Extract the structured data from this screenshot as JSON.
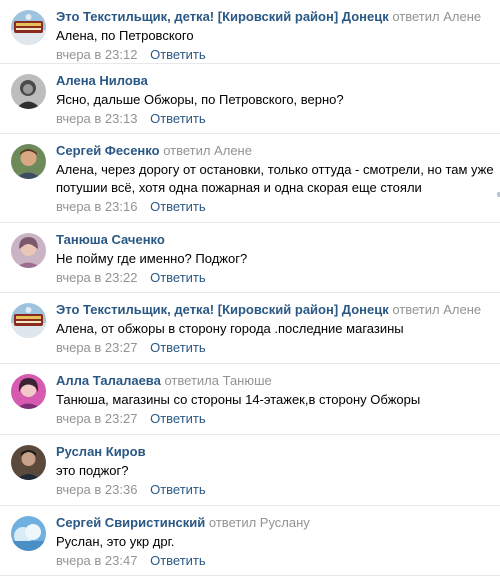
{
  "reply_label": "Ответить",
  "comments": [
    {
      "author": "Это Текстильщик, детка! [Кировский район] Донецк",
      "replied": "ответил Алене",
      "text": "Алена, по Петровского",
      "time": "вчера в 23:12",
      "avatar": "community-badge-avatar"
    },
    {
      "author": "Алена Нилова",
      "replied": "",
      "text": "Ясно, дальше Обжоры, по Петровского, верно?",
      "time": "вчера в 23:13",
      "avatar": "grayscale-portrait-avatar"
    },
    {
      "author": "Сергей Фесенко",
      "replied": "ответил Алене",
      "text": "Алена, через дорогу от остановки, только оттуда - смотрели, но там уже потушии всё, хотя одна пожарная и одна скорая еще стояли",
      "time": "вчера в 23:16",
      "avatar": "man-portrait-avatar"
    },
    {
      "author": "Танюша Саченко",
      "replied": "",
      "text": "Не пойму где именно? Поджог?",
      "time": "вчера в 23:22",
      "avatar": "woman-portrait-avatar"
    },
    {
      "author": "Это Текстильщик, детка! [Кировский район] Донецк",
      "replied": "ответил Алене",
      "text": "Алена, от обжоры в сторону города .последние магазины",
      "time": "вчера в 23:27",
      "avatar": "community-badge-avatar"
    },
    {
      "author": "Алла Талалаева",
      "replied": "ответила Танюше",
      "text": "Танюша, магазины со стороны 14-этажек,в сторону Обжоры",
      "time": "вчера в 23:27",
      "avatar": "pink-portrait-avatar"
    },
    {
      "author": "Руслан Киров",
      "replied": "",
      "text": "это поджог?",
      "time": "вчера в 23:36",
      "avatar": "dark-portrait-avatar"
    },
    {
      "author": "Сергей Свиристинский",
      "replied": "ответил Руслану",
      "text": "Руслан, это укр дрг.",
      "time": "вчера в 23:47",
      "avatar": "blue-sky-avatar"
    }
  ]
}
